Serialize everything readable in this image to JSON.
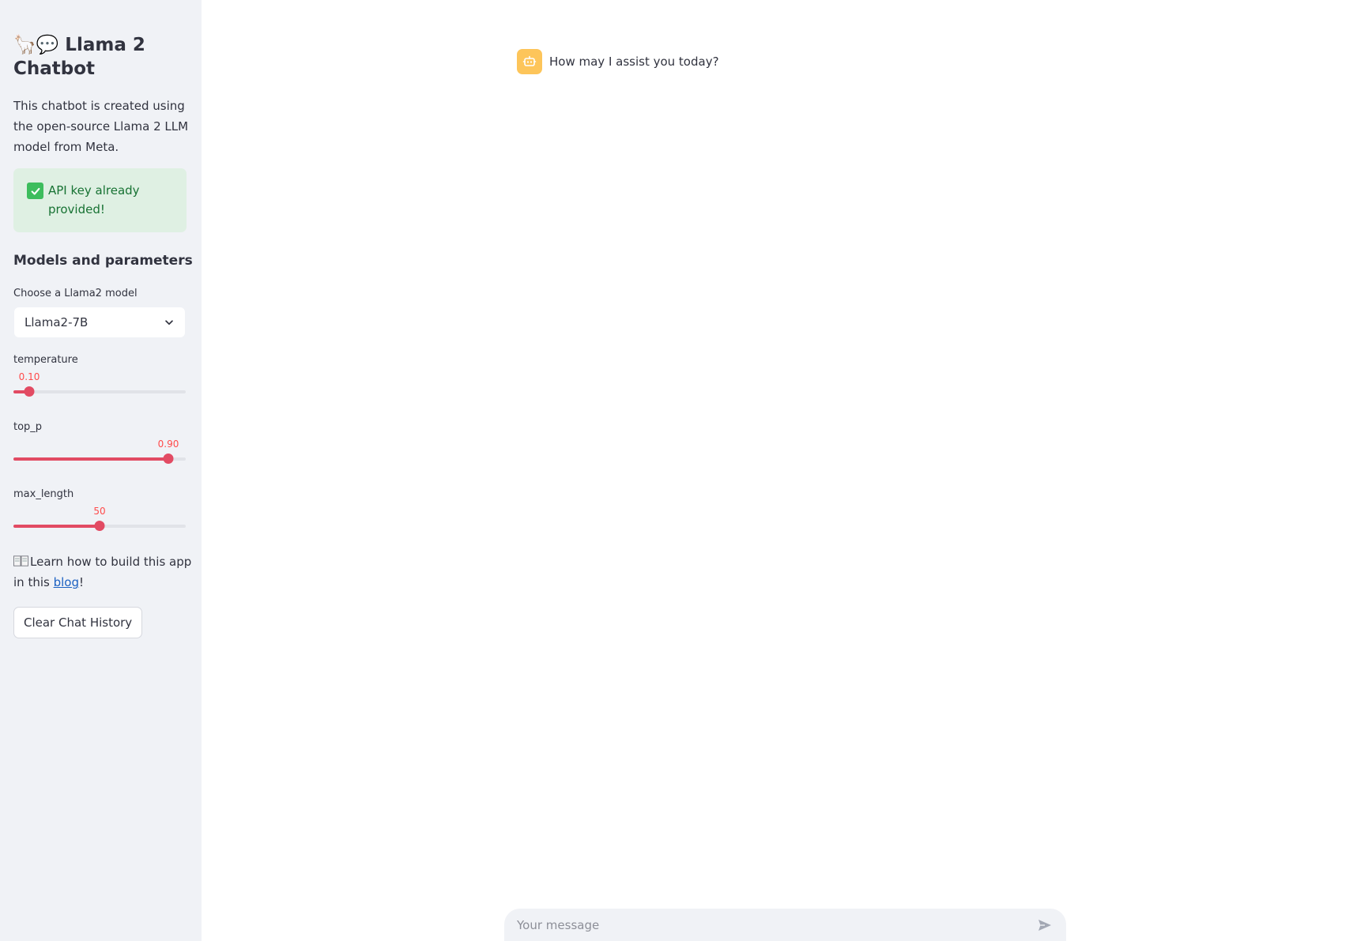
{
  "sidebar": {
    "title_emoji": "🦙💬",
    "title": "Llama 2 Chatbot",
    "description": "This chatbot is created using the open-source Llama 2 LLM model from Meta.",
    "alert": "API key already provided!",
    "section_heading": "Models and parameters",
    "model_select": {
      "label": "Choose a Llama2 model",
      "value": "Llama2-7B"
    },
    "sliders": [
      {
        "label": "temperature",
        "value_text": "0.10",
        "fraction": 0.09
      },
      {
        "label": "top_p",
        "value_text": "0.90",
        "fraction": 0.9
      },
      {
        "label": "max_length",
        "value_text": "50",
        "fraction": 0.5
      }
    ],
    "learn_prefix": "Learn how to build this app in this ",
    "learn_link": "blog",
    "learn_suffix": "!",
    "clear_button": "Clear Chat History"
  },
  "chat": {
    "messages": [
      {
        "role": "assistant",
        "text": "How may I assist you today?"
      }
    ],
    "input_placeholder": "Your message"
  },
  "colors": {
    "accent": "#e24b63",
    "sidebar_bg": "#f0f2f6",
    "success_bg": "#dff0e3",
    "success_text": "#177233",
    "avatar_bg": "#fdc55a"
  }
}
